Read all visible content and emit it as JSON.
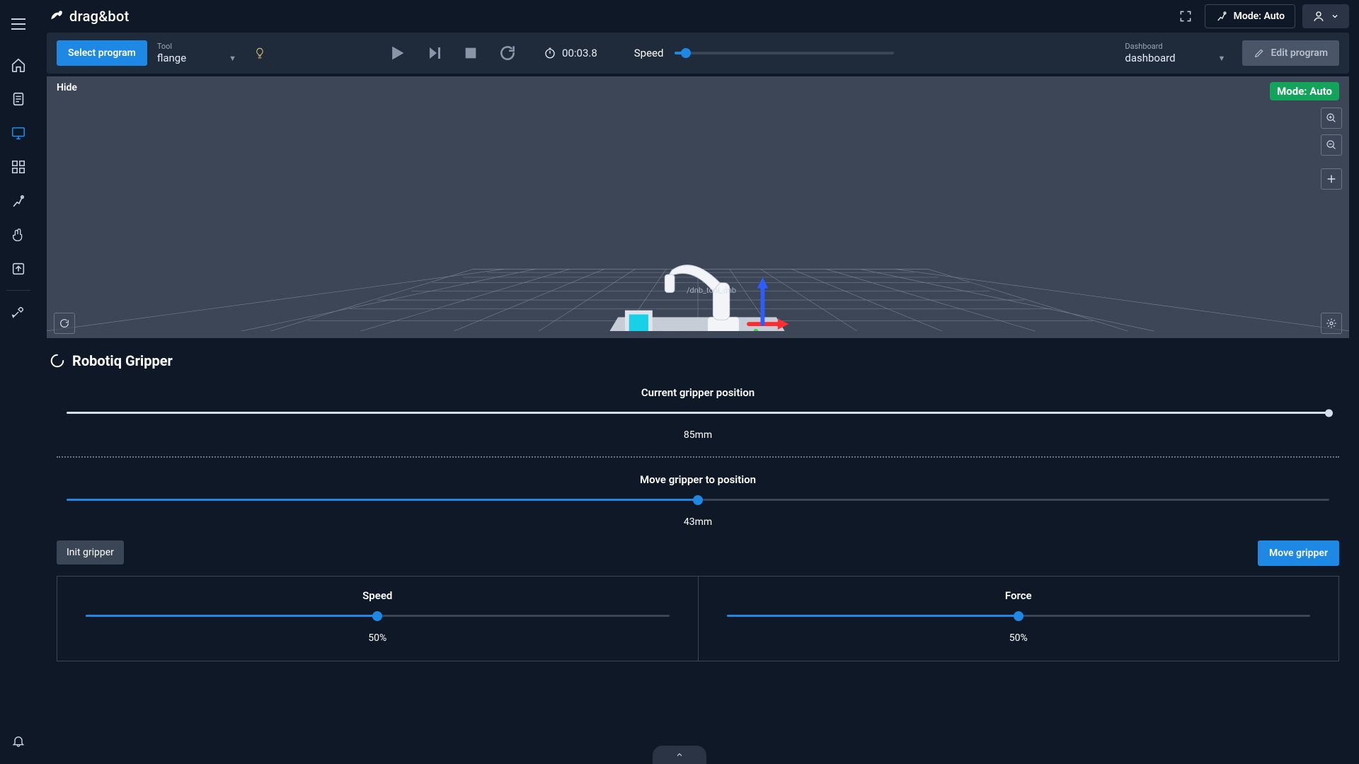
{
  "app": {
    "name": "drag&bot"
  },
  "topbar": {
    "mode_label": "Mode: Auto"
  },
  "toolbar": {
    "select_program": "Select program",
    "tool_label": "Tool",
    "tool_value": "flange",
    "timer": "00:03.8",
    "speed_label": "Speed",
    "speed_percent": 5,
    "dashboard_label": "Dashboard",
    "dashboard_value": "dashboard",
    "edit_program": "Edit program"
  },
  "viewport": {
    "hide": "Hide",
    "mode_badge": "Mode: Auto",
    "scene_label": "/dnb_tool_dnb"
  },
  "panel": {
    "title": "Robotiq Gripper",
    "current_label": "Current gripper position",
    "current_value": "85mm",
    "move_label": "Move gripper to position",
    "move_value": "43mm",
    "move_percent": 50,
    "init_btn": "Init gripper",
    "move_btn": "Move gripper",
    "speed_label": "Speed",
    "speed_value": "50%",
    "speed_percent": 50,
    "force_label": "Force",
    "force_value": "50%",
    "force_percent": 50
  }
}
